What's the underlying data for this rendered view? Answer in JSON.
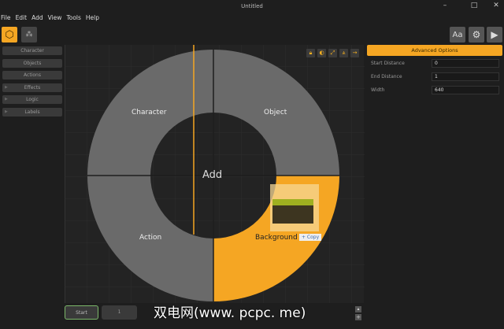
{
  "window": {
    "title": "Untitled"
  },
  "menu": [
    "File",
    "Edit",
    "Add",
    "View",
    "Tools",
    "Help"
  ],
  "sidebar": [
    "Character",
    "Objects",
    "Actions",
    "Effects",
    "Logic",
    "Labels"
  ],
  "donut": {
    "center": "Add",
    "segments": [
      "Character",
      "Object",
      "Action",
      "Background"
    ],
    "accent": "#f5a623"
  },
  "drag": {
    "copy_label": "+ Copy"
  },
  "panel": {
    "title": "Advanced Options",
    "fields": [
      {
        "label": "Start Distance",
        "value": "0"
      },
      {
        "label": "End Distance",
        "value": "1"
      },
      {
        "label": "Width",
        "value": "640"
      }
    ]
  },
  "topright": {
    "font_label": "Aa"
  },
  "bottom": {
    "start": "Start",
    "value": "1"
  },
  "watermark": "双电网(www. pcpc. me)"
}
